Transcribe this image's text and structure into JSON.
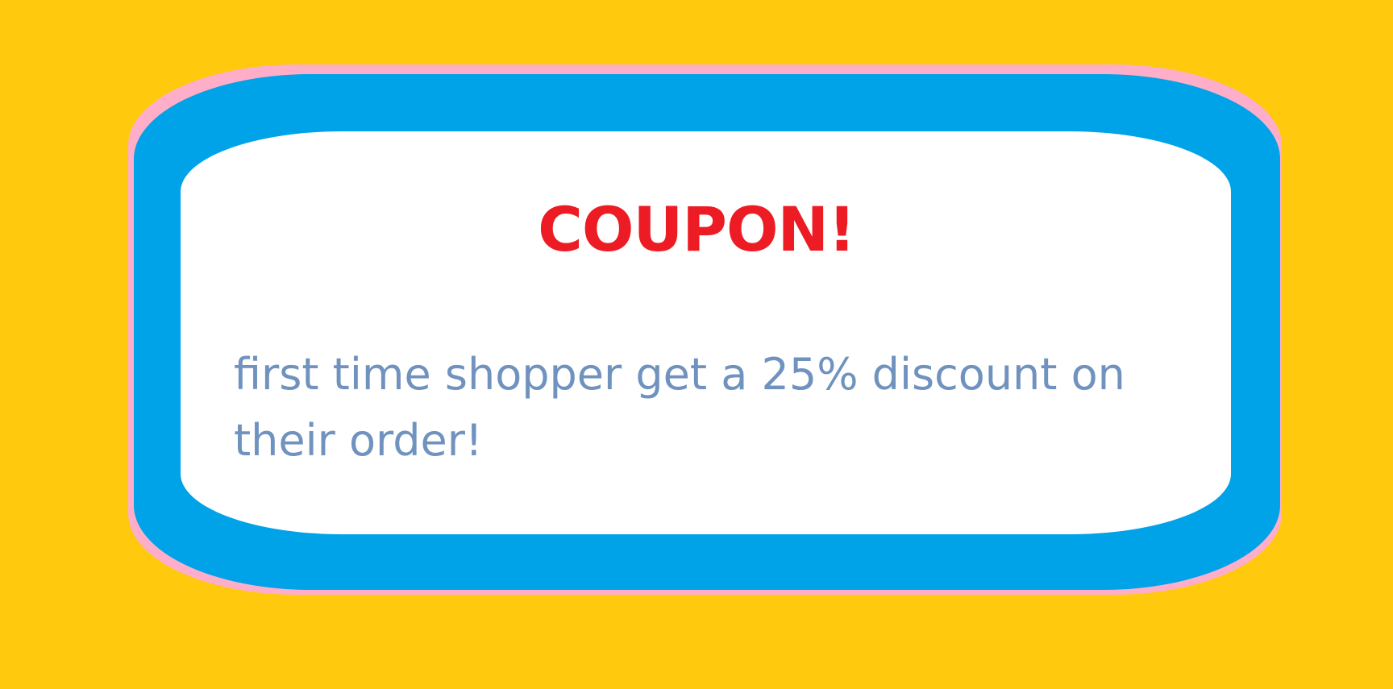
{
  "coupon": {
    "title": "COUPON!",
    "message": "first time shopper get a 25% discount on their order!"
  },
  "colors": {
    "background": "#FFC90E",
    "border": "#00A2E8",
    "halo": "#FFAEC9",
    "card": "#FFFFFF",
    "title": "#ED1C24",
    "message": "#7092BE"
  }
}
